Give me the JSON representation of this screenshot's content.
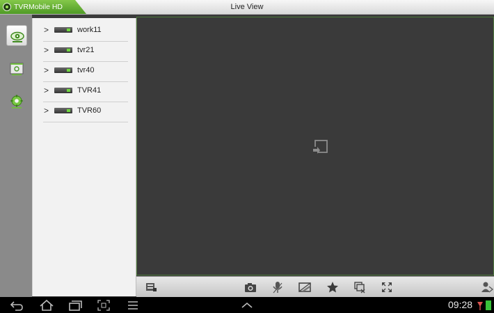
{
  "app": {
    "name": "TVRMobile HD",
    "page_title": "Live View"
  },
  "rail": {
    "items": [
      {
        "name": "live-view",
        "icon": "eye-icon",
        "active": true
      },
      {
        "name": "playback",
        "icon": "playback-icon",
        "active": false
      },
      {
        "name": "settings",
        "icon": "gear-icon",
        "active": false
      }
    ]
  },
  "devices": [
    {
      "label": "work11"
    },
    {
      "label": "tvr21"
    },
    {
      "label": "tvr40"
    },
    {
      "label": "TVR41"
    },
    {
      "label": "TVR60"
    }
  ],
  "toolbar": {
    "items": [
      "stream-icon",
      "snapshot-icon",
      "microphone-icon",
      "image-adjust-icon",
      "favorite-star-icon",
      "close-window-icon",
      "fullscreen-icon",
      "ptz-user-icon"
    ]
  },
  "system": {
    "time": "09:28"
  },
  "colors": {
    "accent": "#5aa82e",
    "panel": "#f2f2f2",
    "video": "#3a3a3a"
  }
}
